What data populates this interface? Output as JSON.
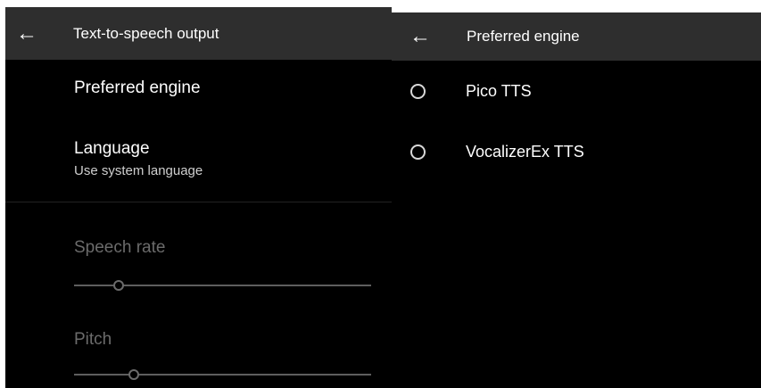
{
  "left": {
    "header": {
      "back_icon": "arrow-left-icon",
      "title": "Text-to-speech output"
    },
    "preferred_engine": {
      "title": "Preferred engine"
    },
    "language": {
      "title": "Language",
      "summary": "Use system language"
    },
    "speech_rate": {
      "title": "Speech rate",
      "value": 0.15
    },
    "pitch": {
      "title": "Pitch",
      "value": 0.2
    }
  },
  "right": {
    "header": {
      "back_icon": "arrow-left-icon",
      "title": "Preferred engine"
    },
    "options": [
      {
        "label": "Pico TTS",
        "selected": false
      },
      {
        "label": "VocalizerEx TTS",
        "selected": false
      }
    ]
  }
}
